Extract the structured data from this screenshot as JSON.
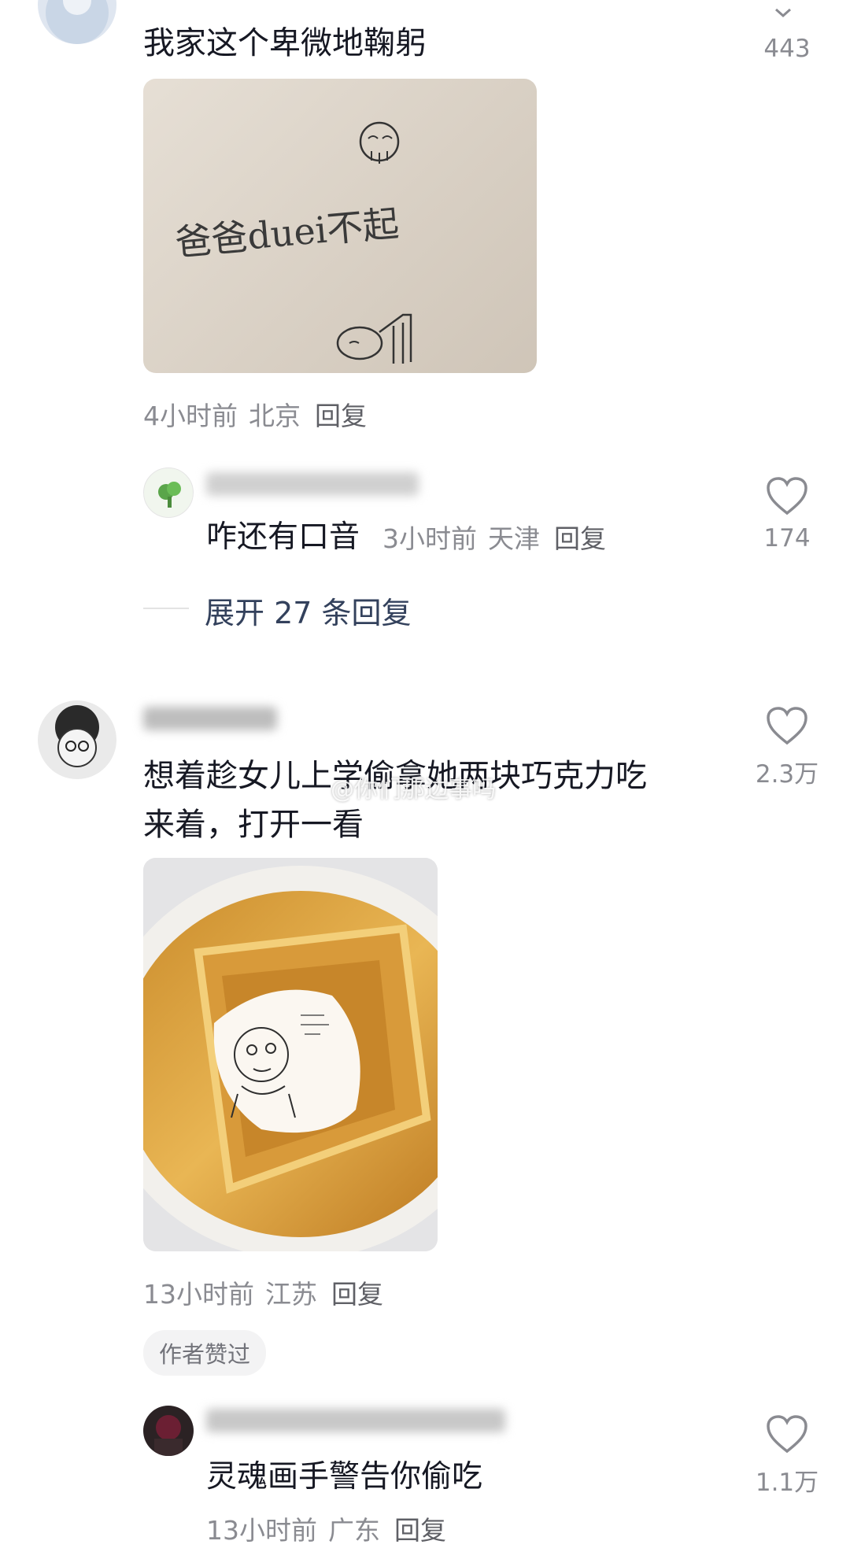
{
  "comments": [
    {
      "text": "我家这个卑微地鞠躬",
      "image_note": "爸爸duei不起",
      "time": "4小时前",
      "location": "北京",
      "reply_label": "回复",
      "likes": "443",
      "replies": [
        {
          "text": "咋还有口音",
          "time": "3小时前",
          "location": "天津",
          "reply_label": "回复",
          "likes": "174"
        }
      ],
      "expand_label": "展开 27 条回复"
    },
    {
      "text_line1": "想着趁女儿上学偷拿她两块巧克力吃",
      "text_line2": "来着，打开一看",
      "time": "13小时前",
      "location": "江苏",
      "reply_label": "回复",
      "likes": "2.3万",
      "author_badge": "作者赞过",
      "replies": [
        {
          "text": "灵魂画手警告你偷吃",
          "time": "13小时前",
          "location": "广东",
          "reply_label": "回复",
          "likes": "1.1万"
        }
      ]
    }
  ],
  "watermark": "@你们那边事吗",
  "colors": {
    "text": "#161823",
    "meta": "#8a8b91",
    "link": "#33415c"
  }
}
